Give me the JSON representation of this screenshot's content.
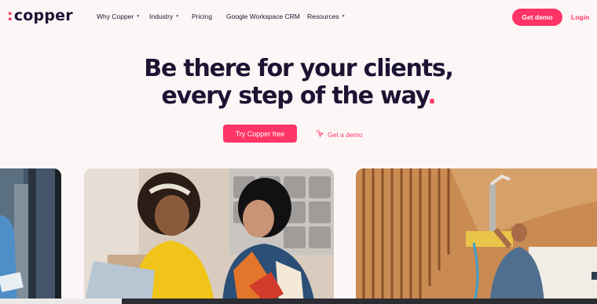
{
  "brand": {
    "name": "copper",
    "accent": "#ff3466",
    "ink": "#1c1433",
    "background": "#fcf7f6"
  },
  "nav": {
    "items": [
      {
        "label": "Why Copper",
        "dropdown": true
      },
      {
        "label": "Industry",
        "dropdown": true
      },
      {
        "label": "Pricing",
        "dropdown": false
      },
      {
        "label": "Google Workspace CRM",
        "dropdown": false
      },
      {
        "label": "Resources",
        "dropdown": true
      }
    ],
    "cta_label": "Get demo",
    "login_label": "Login"
  },
  "hero": {
    "line1": "Be there for your clients,",
    "line2": "every step of the way",
    "line2_dot": "."
  },
  "actions": {
    "primary_label": "Try Copper free",
    "secondary_label": "Get a demo",
    "secondary_icon": "cursor-click-icon"
  },
  "icons": {
    "dropdown": "chevron-down-icon"
  }
}
